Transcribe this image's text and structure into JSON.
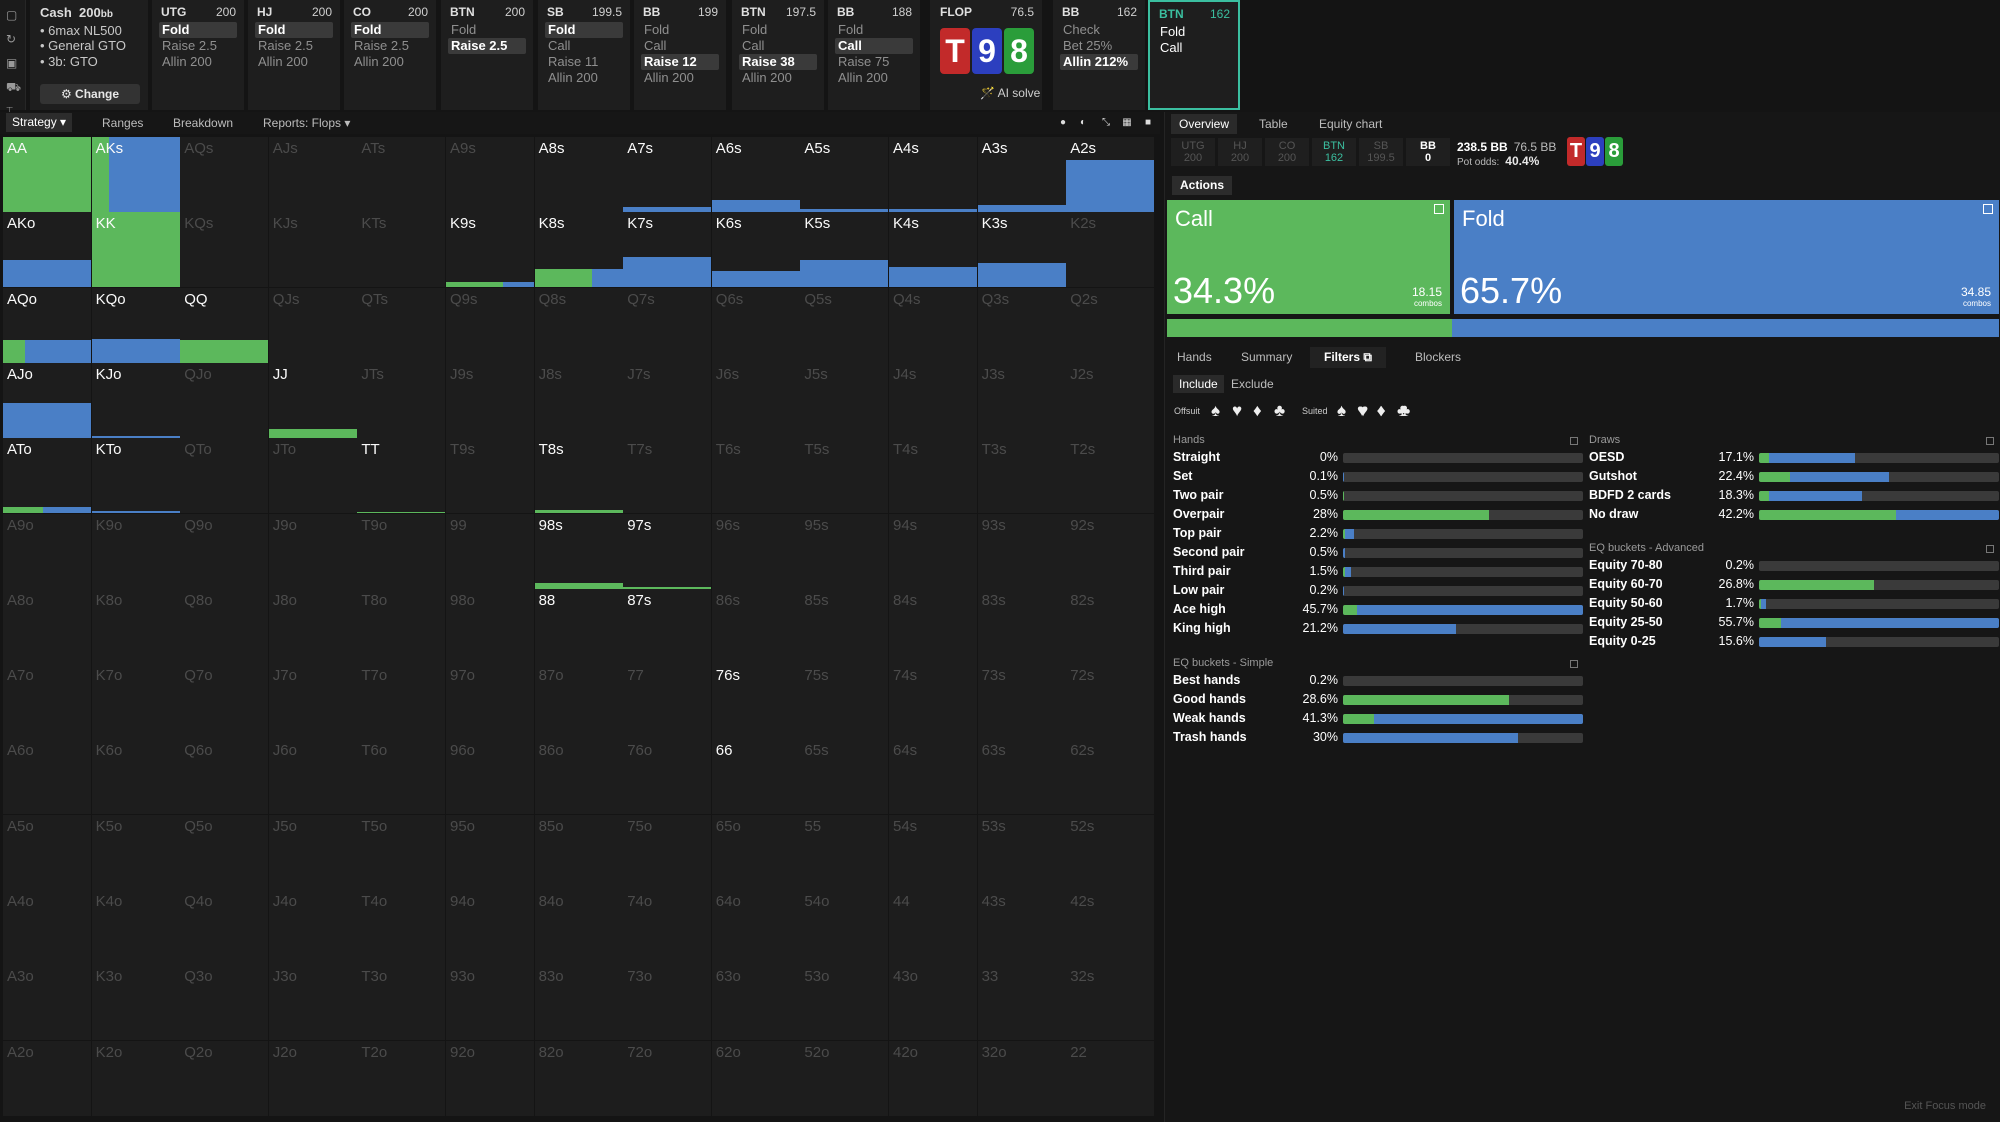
{
  "config": {
    "title": "Cash",
    "stack": "200",
    "stack_unit": "bb",
    "items": [
      "• 6max NL500",
      "• General GTO",
      "• 3b: GTO"
    ],
    "change_label": "⚙ Change"
  },
  "leftbar_icons": [
    "layout-icon",
    "history-icon",
    "save-icon",
    "car-icon",
    "text-cursor-icon"
  ],
  "cards": [
    {
      "pos": "UTG",
      "stack": "200",
      "actions": [
        "Fold",
        "Raise 2.5",
        "Allin 200"
      ],
      "sel": 0
    },
    {
      "pos": "HJ",
      "stack": "200",
      "actions": [
        "Fold",
        "Raise 2.5",
        "Allin 200"
      ],
      "sel": 0
    },
    {
      "pos": "CO",
      "stack": "200",
      "actions": [
        "Fold",
        "Raise 2.5",
        "Allin 200"
      ],
      "sel": 0
    },
    {
      "pos": "BTN",
      "stack": "200",
      "actions": [
        "Fold",
        "Raise 2.5"
      ],
      "sel": 1
    },
    {
      "pos": "SB",
      "stack": "199.5",
      "actions": [
        "Fold",
        "Call",
        "Raise 11",
        "Allin 200"
      ],
      "sel": 0
    },
    {
      "pos": "BB",
      "stack": "199",
      "actions": [
        "Fold",
        "Call",
        "Raise 12",
        "Allin 200"
      ],
      "sel": 2
    },
    {
      "pos": "BTN",
      "stack": "197.5",
      "actions": [
        "Fold",
        "Call",
        "Raise 38",
        "Allin 200"
      ],
      "sel": 2
    },
    {
      "pos": "BB",
      "stack": "188",
      "actions": [
        "Fold",
        "Call",
        "Raise 75",
        "Allin 200"
      ],
      "sel": 1
    }
  ],
  "flop": {
    "label": "FLOP",
    "pot": "76.5",
    "cards": [
      {
        "rank": "T",
        "color": "#c22a2a"
      },
      {
        "rank": "9",
        "color": "#2c3fbf"
      },
      {
        "rank": "8",
        "color": "#2a9d3a"
      }
    ],
    "ai_label": "🪄 AI solve"
  },
  "bb_card": {
    "pos": "BB",
    "stack": "162",
    "actions": [
      "Check",
      "Bet 25%",
      "Allin 212%"
    ],
    "sel": 2
  },
  "btn_card": {
    "pos": "BTN",
    "stack": "162",
    "actions": [
      "Fold",
      "Call"
    ]
  },
  "strat_tabs": [
    "Strategy ▾",
    "Ranges",
    "Breakdown",
    "Reports: Flops ▾"
  ],
  "view_icons": [
    "circle-icon",
    "half-icon",
    "compress-icon",
    "grid-icon",
    "square-icon"
  ],
  "grid_cells": [
    [
      "AA",
      "a",
      [
        [
          "g",
          1,
          1
        ]
      ]
    ],
    [
      "AKs",
      "a",
      [
        [
          "g",
          0.2,
          1
        ],
        [
          "b",
          0.8,
          1
        ]
      ]
    ],
    [
      "AQs",
      "d",
      []
    ],
    [
      "AJs",
      "d",
      []
    ],
    [
      "ATs",
      "d",
      []
    ],
    [
      "A9s",
      "d",
      []
    ],
    [
      "A8s",
      "a",
      []
    ],
    [
      "A7s",
      "a",
      [
        [
          "b",
          1,
          0.07
        ]
      ]
    ],
    [
      "A6s",
      "a",
      [
        [
          "b",
          1,
          0.16
        ]
      ]
    ],
    [
      "A5s",
      "a",
      [
        [
          "b",
          1,
          0.04
        ]
      ]
    ],
    [
      "A4s",
      "a",
      [
        [
          "b",
          1,
          0.04
        ]
      ]
    ],
    [
      "A3s",
      "a",
      [
        [
          "b",
          1,
          0.1
        ]
      ]
    ],
    [
      "A2s",
      "a",
      [
        [
          "b",
          1,
          0.7
        ]
      ]
    ],
    [
      "AKo",
      "a",
      [
        [
          "b",
          1,
          0.37
        ]
      ]
    ],
    [
      "KK",
      "a",
      [
        [
          "g",
          1,
          1
        ]
      ]
    ],
    [
      "KQs",
      "d",
      []
    ],
    [
      "KJs",
      "d",
      []
    ],
    [
      "KTs",
      "d",
      []
    ],
    [
      "K9s",
      "a",
      [
        [
          "g",
          0.65,
          0.07
        ],
        [
          "b",
          0.35,
          0.07
        ]
      ]
    ],
    [
      "K8s",
      "a",
      [
        [
          "g",
          0.65,
          0.24
        ],
        [
          "b",
          0.35,
          0.24
        ]
      ]
    ],
    [
      "K7s",
      "a",
      [
        [
          "b",
          1,
          0.4
        ]
      ]
    ],
    [
      "K6s",
      "a",
      [
        [
          "b",
          1,
          0.22
        ]
      ]
    ],
    [
      "K5s",
      "a",
      [
        [
          "b",
          1,
          0.37
        ]
      ]
    ],
    [
      "K4s",
      "a",
      [
        [
          "b",
          1,
          0.27
        ]
      ]
    ],
    [
      "K3s",
      "a",
      [
        [
          "b",
          1,
          0.32
        ]
      ]
    ],
    [
      "K2s",
      "d",
      []
    ],
    [
      "AQo",
      "a",
      [
        [
          "g",
          0.25,
          0.3
        ],
        [
          "b",
          0.75,
          0.3
        ]
      ]
    ],
    [
      "KQo",
      "a",
      [
        [
          "b",
          1,
          0.32
        ]
      ]
    ],
    [
      "QQ",
      "a",
      [
        [
          "g",
          1,
          0.3
        ]
      ]
    ],
    [
      "QJs",
      "d",
      []
    ],
    [
      "QTs",
      "d",
      []
    ],
    [
      "Q9s",
      "d",
      []
    ],
    [
      "Q8s",
      "d",
      []
    ],
    [
      "Q7s",
      "d",
      []
    ],
    [
      "Q6s",
      "d",
      []
    ],
    [
      "Q5s",
      "d",
      []
    ],
    [
      "Q4s",
      "d",
      []
    ],
    [
      "Q3s",
      "d",
      []
    ],
    [
      "Q2s",
      "d",
      []
    ],
    [
      "AJo",
      "a",
      [
        [
          "b",
          1,
          0.47
        ]
      ]
    ],
    [
      "KJo",
      "a",
      [
        [
          "b",
          1,
          0.03
        ]
      ]
    ],
    [
      "QJo",
      "d",
      []
    ],
    [
      "JJ",
      "a",
      [
        [
          "g",
          1,
          0.12
        ]
      ]
    ],
    [
      "JTs",
      "d",
      []
    ],
    [
      "J9s",
      "d",
      []
    ],
    [
      "J8s",
      "d",
      []
    ],
    [
      "J7s",
      "d",
      []
    ],
    [
      "J6s",
      "d",
      []
    ],
    [
      "J5s",
      "d",
      []
    ],
    [
      "J4s",
      "d",
      []
    ],
    [
      "J3s",
      "d",
      []
    ],
    [
      "J2s",
      "d",
      []
    ],
    [
      "ATo",
      "a",
      [
        [
          "g",
          0.45,
          0.08
        ],
        [
          "b",
          0.55,
          0.08
        ]
      ]
    ],
    [
      "KTo",
      "a",
      [
        [
          "b",
          1,
          0.03
        ]
      ]
    ],
    [
      "QTo",
      "d",
      []
    ],
    [
      "JTo",
      "d",
      []
    ],
    [
      "TT",
      "a",
      [
        [
          "g",
          1,
          0.02
        ]
      ]
    ],
    [
      "T9s",
      "d",
      []
    ],
    [
      "T8s",
      "a",
      [
        [
          "g",
          1,
          0.04
        ]
      ]
    ],
    [
      "T7s",
      "d",
      []
    ],
    [
      "T6s",
      "d",
      []
    ],
    [
      "T5s",
      "d",
      []
    ],
    [
      "T4s",
      "d",
      []
    ],
    [
      "T3s",
      "d",
      []
    ],
    [
      "T2s",
      "d",
      []
    ],
    [
      "A9o",
      "d",
      []
    ],
    [
      "K9o",
      "d",
      []
    ],
    [
      "Q9o",
      "d",
      []
    ],
    [
      "J9o",
      "d",
      []
    ],
    [
      "T9o",
      "d",
      []
    ],
    [
      "99",
      "d",
      []
    ],
    [
      "98s",
      "a",
      [
        [
          "g",
          1,
          0.07
        ]
      ]
    ],
    [
      "97s",
      "a",
      [
        [
          "g",
          1,
          0.02
        ]
      ]
    ],
    [
      "96s",
      "d",
      []
    ],
    [
      "95s",
      "d",
      []
    ],
    [
      "94s",
      "d",
      []
    ],
    [
      "93s",
      "d",
      []
    ],
    [
      "92s",
      "d",
      []
    ],
    [
      "A8o",
      "d",
      []
    ],
    [
      "K8o",
      "d",
      []
    ],
    [
      "Q8o",
      "d",
      []
    ],
    [
      "J8o",
      "d",
      []
    ],
    [
      "T8o",
      "d",
      []
    ],
    [
      "98o",
      "d",
      []
    ],
    [
      "88",
      "a",
      []
    ],
    [
      "87s",
      "a",
      []
    ],
    [
      "86s",
      "d",
      []
    ],
    [
      "85s",
      "d",
      []
    ],
    [
      "84s",
      "d",
      []
    ],
    [
      "83s",
      "d",
      []
    ],
    [
      "82s",
      "d",
      []
    ],
    [
      "A7o",
      "d",
      []
    ],
    [
      "K7o",
      "d",
      []
    ],
    [
      "Q7o",
      "d",
      []
    ],
    [
      "J7o",
      "d",
      []
    ],
    [
      "T7o",
      "d",
      []
    ],
    [
      "97o",
      "d",
      []
    ],
    [
      "87o",
      "d",
      []
    ],
    [
      "77",
      "d",
      []
    ],
    [
      "76s",
      "a",
      []
    ],
    [
      "75s",
      "d",
      []
    ],
    [
      "74s",
      "d",
      []
    ],
    [
      "73s",
      "d",
      []
    ],
    [
      "72s",
      "d",
      []
    ],
    [
      "A6o",
      "d",
      []
    ],
    [
      "K6o",
      "d",
      []
    ],
    [
      "Q6o",
      "d",
      []
    ],
    [
      "J6o",
      "d",
      []
    ],
    [
      "T6o",
      "d",
      []
    ],
    [
      "96o",
      "d",
      []
    ],
    [
      "86o",
      "d",
      []
    ],
    [
      "76o",
      "d",
      []
    ],
    [
      "66",
      "a",
      [
        [
          "b",
          1,
          0.01
        ]
      ]
    ],
    [
      "65s",
      "d",
      []
    ],
    [
      "64s",
      "d",
      []
    ],
    [
      "63s",
      "d",
      []
    ],
    [
      "62s",
      "d",
      []
    ],
    [
      "A5o",
      "d",
      []
    ],
    [
      "K5o",
      "d",
      []
    ],
    [
      "Q5o",
      "d",
      []
    ],
    [
      "J5o",
      "d",
      []
    ],
    [
      "T5o",
      "d",
      []
    ],
    [
      "95o",
      "d",
      []
    ],
    [
      "85o",
      "d",
      []
    ],
    [
      "75o",
      "d",
      []
    ],
    [
      "65o",
      "d",
      []
    ],
    [
      "55",
      "d",
      []
    ],
    [
      "54s",
      "d",
      []
    ],
    [
      "53s",
      "d",
      []
    ],
    [
      "52s",
      "d",
      []
    ],
    [
      "A4o",
      "d",
      []
    ],
    [
      "K4o",
      "d",
      []
    ],
    [
      "Q4o",
      "d",
      []
    ],
    [
      "J4o",
      "d",
      []
    ],
    [
      "T4o",
      "d",
      []
    ],
    [
      "94o",
      "d",
      []
    ],
    [
      "84o",
      "d",
      []
    ],
    [
      "74o",
      "d",
      []
    ],
    [
      "64o",
      "d",
      []
    ],
    [
      "54o",
      "d",
      []
    ],
    [
      "44",
      "d",
      []
    ],
    [
      "43s",
      "d",
      []
    ],
    [
      "42s",
      "d",
      []
    ],
    [
      "A3o",
      "d",
      []
    ],
    [
      "K3o",
      "d",
      []
    ],
    [
      "Q3o",
      "d",
      []
    ],
    [
      "J3o",
      "d",
      []
    ],
    [
      "T3o",
      "d",
      []
    ],
    [
      "93o",
      "d",
      []
    ],
    [
      "83o",
      "d",
      []
    ],
    [
      "73o",
      "d",
      []
    ],
    [
      "63o",
      "d",
      []
    ],
    [
      "53o",
      "d",
      []
    ],
    [
      "43o",
      "d",
      []
    ],
    [
      "33",
      "d",
      []
    ],
    [
      "32s",
      "d",
      []
    ],
    [
      "A2o",
      "d",
      []
    ],
    [
      "K2o",
      "d",
      []
    ],
    [
      "Q2o",
      "d",
      []
    ],
    [
      "J2o",
      "d",
      []
    ],
    [
      "T2o",
      "d",
      []
    ],
    [
      "92o",
      "d",
      []
    ],
    [
      "82o",
      "d",
      []
    ],
    [
      "72o",
      "d",
      []
    ],
    [
      "62o",
      "d",
      []
    ],
    [
      "52o",
      "d",
      []
    ],
    [
      "42o",
      "d",
      []
    ],
    [
      "32o",
      "d",
      []
    ],
    [
      "22",
      "d",
      []
    ]
  ],
  "right": {
    "tabs": [
      "Overview",
      "Table",
      "Equity chart"
    ],
    "players": [
      {
        "pos": "UTG",
        "stack": "200"
      },
      {
        "pos": "HJ",
        "stack": "200"
      },
      {
        "pos": "CO",
        "stack": "200"
      },
      {
        "pos": "BTN",
        "stack": "162"
      },
      {
        "pos": "SB",
        "stack": "199.5"
      },
      {
        "pos": "BB",
        "stack": "0"
      }
    ],
    "pot": "238.5 BB",
    "pot_sub": "76.5 BB",
    "pot_odds_label": "Pot odds:",
    "pot_odds": "40.4%",
    "actions_label": "Actions ▾",
    "call": {
      "label": "Call",
      "pct": "34.3%",
      "combos": "18.15",
      "combos_label": "combos",
      "value": 0.343
    },
    "fold": {
      "label": "Fold",
      "pct": "65.7%",
      "combos": "34.85",
      "combos_label": "combos",
      "value": 0.657
    },
    "bottom_tabs": [
      "Hands",
      "Summary",
      "Filters ⧉",
      "Blockers"
    ],
    "include": "Include",
    "exclude": "Exclude",
    "offsuit_label": "Offsuit",
    "suited_label": "Suited",
    "offsuit_suits": [
      "♠",
      "♥",
      "♦",
      "♣"
    ],
    "suited_suits": [
      "♠♠",
      "♥♥",
      "♦♦",
      "♣♣"
    ],
    "hands_title": "Hands",
    "hands": [
      {
        "name": "Straight",
        "pct": "0%",
        "g": 0,
        "b": 0
      },
      {
        "name": "Set",
        "pct": "0.1%",
        "g": 0,
        "b": 0.001
      },
      {
        "name": "Two pair",
        "pct": "0.5%",
        "g": 0.005,
        "b": 0
      },
      {
        "name": "Overpair",
        "pct": "28%",
        "g": 0.61,
        "b": 0
      },
      {
        "name": "Top pair",
        "pct": "2.2%",
        "g": 0.01,
        "b": 0.035
      },
      {
        "name": "Second pair",
        "pct": "0.5%",
        "g": 0,
        "b": 0.008
      },
      {
        "name": "Third pair",
        "pct": "1.5%",
        "g": 0.01,
        "b": 0.025
      },
      {
        "name": "Low pair",
        "pct": "0.2%",
        "g": 0,
        "b": 0.005
      },
      {
        "name": "Ace high",
        "pct": "45.7%",
        "g": 0.06,
        "b": 0.94
      },
      {
        "name": "King high",
        "pct": "21.2%",
        "g": 0,
        "b": 0.47
      }
    ],
    "eqs_title": "EQ buckets - Simple",
    "eqs": [
      {
        "name": "Best hands",
        "pct": "0.2%",
        "g": 0,
        "b": 0
      },
      {
        "name": "Good hands",
        "pct": "28.6%",
        "g": 0.69,
        "b": 0
      },
      {
        "name": "Weak hands",
        "pct": "41.3%",
        "g": 0.13,
        "b": 0.87
      },
      {
        "name": "Trash hands",
        "pct": "30%",
        "g": 0,
        "b": 0.73
      }
    ],
    "draws_title": "Draws",
    "draws": [
      {
        "name": "OESD",
        "pct": "17.1%",
        "g": 0.04,
        "b": 0.36
      },
      {
        "name": "Gutshot",
        "pct": "22.4%",
        "g": 0.13,
        "b": 0.41
      },
      {
        "name": "BDFD 2 cards",
        "pct": "18.3%",
        "g": 0.04,
        "b": 0.39
      },
      {
        "name": "No draw",
        "pct": "42.2%",
        "g": 0.57,
        "b": 0.43
      }
    ],
    "eqa_title": "EQ buckets - Advanced",
    "eqa": [
      {
        "name": "Equity 70-80",
        "pct": "0.2%",
        "g": 0,
        "b": 0
      },
      {
        "name": "Equity 60-70",
        "pct": "26.8%",
        "g": 0.48,
        "b": 0
      },
      {
        "name": "Equity 50-60",
        "pct": "1.7%",
        "g": 0.01,
        "b": 0.02
      },
      {
        "name": "Equity 25-50",
        "pct": "55.7%",
        "g": 0.09,
        "b": 0.91
      },
      {
        "name": "Equity 0-25",
        "pct": "15.6%",
        "g": 0,
        "b": 0.28
      }
    ],
    "exit": "Exit Focus mode"
  },
  "colors": {
    "green": "#5cb85c",
    "blue": "#4a7fc6",
    "accent": "#3bbfa0"
  }
}
